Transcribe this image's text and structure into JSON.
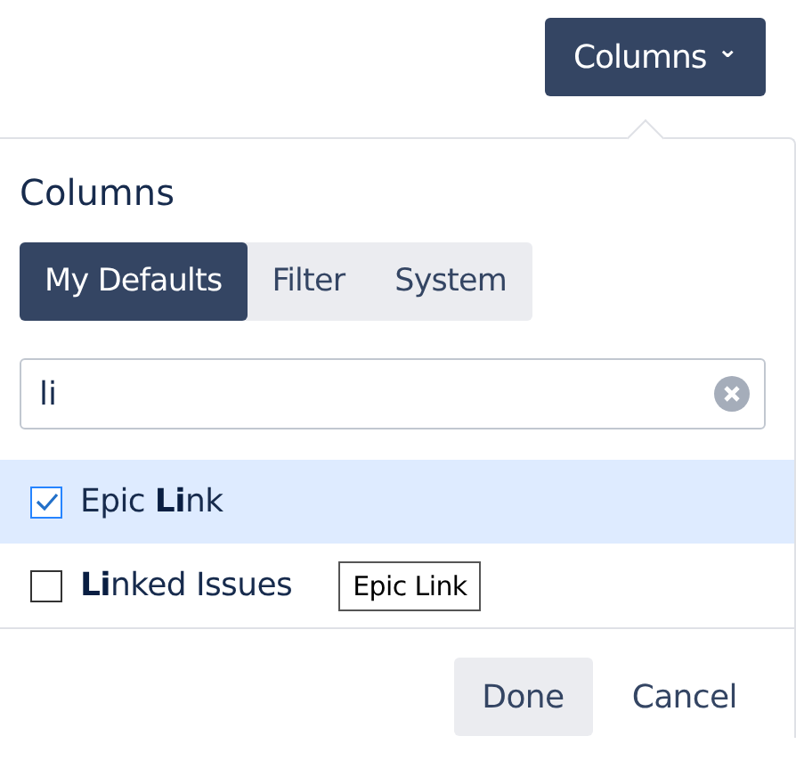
{
  "trigger": {
    "label": "Columns",
    "caret": "⌄"
  },
  "panel": {
    "title": "Columns",
    "tabs": [
      {
        "label": "My Defaults",
        "selected": true
      },
      {
        "label": "Filter",
        "selected": false
      },
      {
        "label": "System",
        "selected": false
      }
    ],
    "search": {
      "value": "li"
    },
    "options": [
      {
        "label": "Epic **Li**nk",
        "checked": true,
        "highlighted": true
      },
      {
        "label": "**Li**nked Issues",
        "checked": false,
        "highlighted": false,
        "tooltip": "Epic Link"
      }
    ],
    "buttons": [
      {
        "label": "Done",
        "kind": "secondary"
      },
      {
        "label": "Cancel",
        "kind": "link"
      }
    ]
  }
}
